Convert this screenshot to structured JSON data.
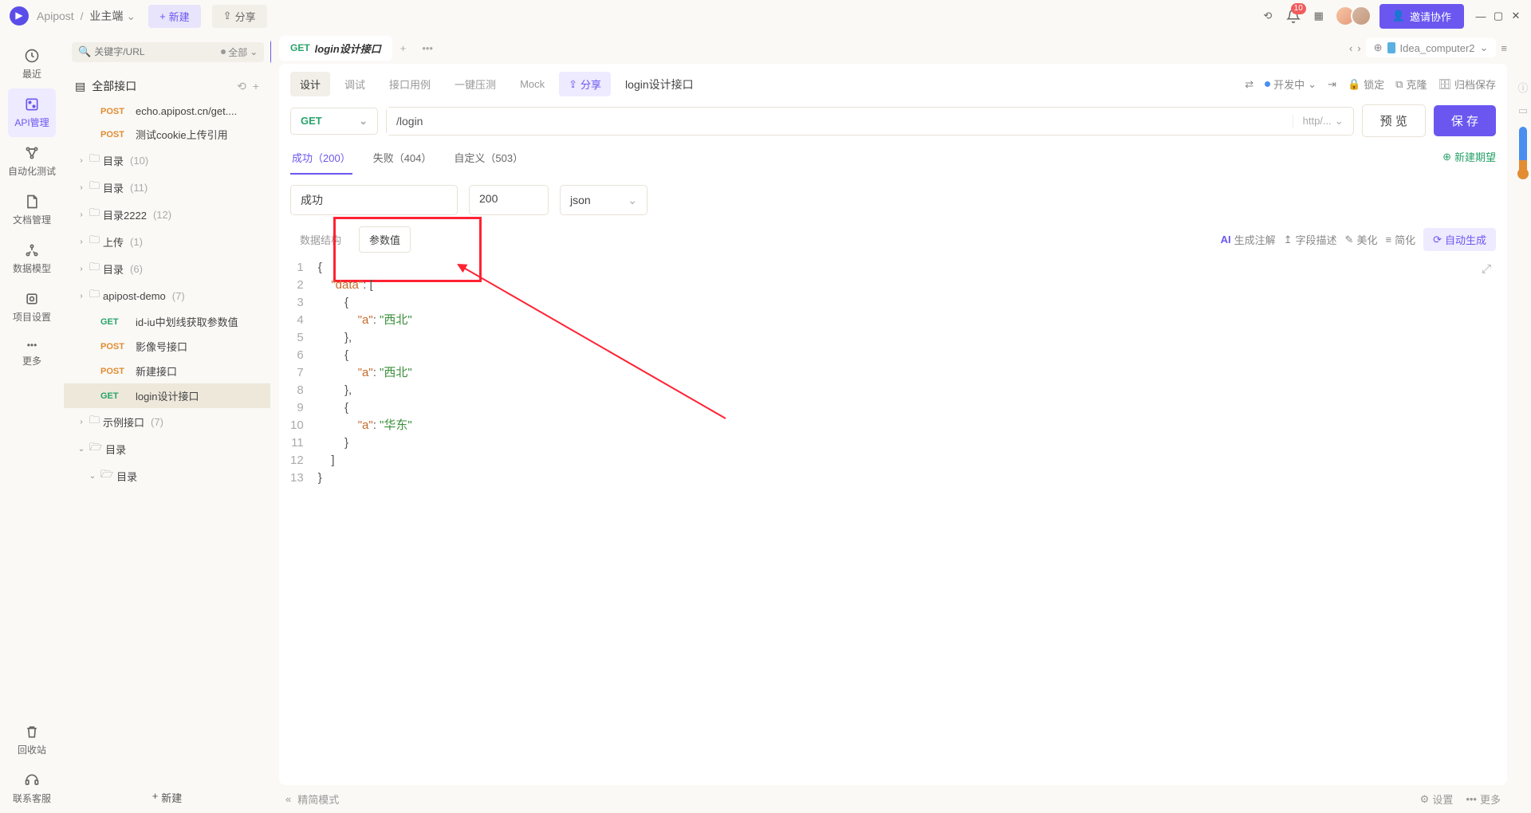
{
  "titlebar": {
    "brand": "Apipost",
    "workspace": "业主端",
    "new_btn": "新建",
    "share_btn": "分享",
    "notif_count": "10",
    "invite_btn": "邀请协作"
  },
  "leftnav": {
    "recent": "最近",
    "api": "API管理",
    "auto": "自动化测试",
    "doc": "文档管理",
    "model": "数据模型",
    "project": "项目设置",
    "more": "更多",
    "trash": "回收站",
    "support": "联系客服"
  },
  "sidebar": {
    "search_placeholder": "关键字/URL",
    "filter_all": "全部",
    "header": "全部接口",
    "items": [
      {
        "method": "POST",
        "label": "echo.apipost.cn/get....",
        "indent": 1
      },
      {
        "method": "POST",
        "label": "测试cookie上传引用",
        "indent": 1
      },
      {
        "tw": "›",
        "folder": true,
        "label": "目录",
        "count": "(10)",
        "indent": 0
      },
      {
        "tw": "›",
        "folder": true,
        "label": "目录",
        "count": "(11)",
        "indent": 0
      },
      {
        "tw": "›",
        "folder": true,
        "label": "目录2222",
        "count": "(12)",
        "indent": 0
      },
      {
        "tw": "›",
        "folder": true,
        "label": "上传",
        "count": "(1)",
        "indent": 0
      },
      {
        "tw": "›",
        "folder": true,
        "label": "目录",
        "count": "(6)",
        "indent": 0
      },
      {
        "tw": "›",
        "folder": true,
        "label": "apipost-demo",
        "count": "(7)",
        "indent": 0
      },
      {
        "method": "GET",
        "label": "id-iu中划线获取参数值",
        "indent": 1
      },
      {
        "method": "POST",
        "label": "影像号接口",
        "indent": 1
      },
      {
        "method": "POST",
        "label": "新建接口",
        "indent": 1
      },
      {
        "method": "GET",
        "label": "login设计接口",
        "indent": 1,
        "selected": true
      },
      {
        "tw": "›",
        "folder": true,
        "label": "示例接口",
        "count": "(7)",
        "indent": 0
      },
      {
        "tw": "⌄",
        "folder": true,
        "label": "目录",
        "indent": 0,
        "open": true
      },
      {
        "tw": "⌄",
        "folder": true,
        "label": "目录",
        "indent": 1,
        "open": true
      }
    ],
    "new_btn": "新建"
  },
  "tabs": {
    "tab_method": "GET",
    "tab_title": "login设计接口",
    "env": "Idea_computer2"
  },
  "subtabs": {
    "design": "设计",
    "debug": "调试",
    "cases": "接口用例",
    "stress": "一键压测",
    "mock": "Mock",
    "share": "分享",
    "api_name": "login设计接口",
    "status": "开发中",
    "lock": "锁定",
    "clone": "克隆",
    "archive": "归档保存"
  },
  "req": {
    "method": "GET",
    "url": "/login",
    "scheme": "http/...",
    "preview": "预 览",
    "save": "保 存"
  },
  "respTabs": {
    "t1": "成功（200）",
    "t2": "失败（404）",
    "t3": "自定义（503）",
    "new_expect": "新建期望"
  },
  "fields": {
    "name": "成功",
    "code": "200",
    "type": "json"
  },
  "toolbar2": {
    "structure": "数据结构",
    "param_value": "参数值",
    "ai_label": "生成注解",
    "field_desc": "字段描述",
    "beautify": "美化",
    "simplify": "简化",
    "auto_gen": "自动生成"
  },
  "editor": {
    "lines": [
      "1",
      "2",
      "3",
      "4",
      "5",
      "6",
      "7",
      "8",
      "9",
      "10",
      "11",
      "12",
      "13"
    ],
    "json": {
      "data": [
        {
          "a": "西北"
        },
        {
          "a": "西北"
        },
        {
          "a": "华东"
        }
      ]
    }
  },
  "footer": {
    "mode": "精简模式",
    "settings": "设置",
    "more": "更多"
  }
}
